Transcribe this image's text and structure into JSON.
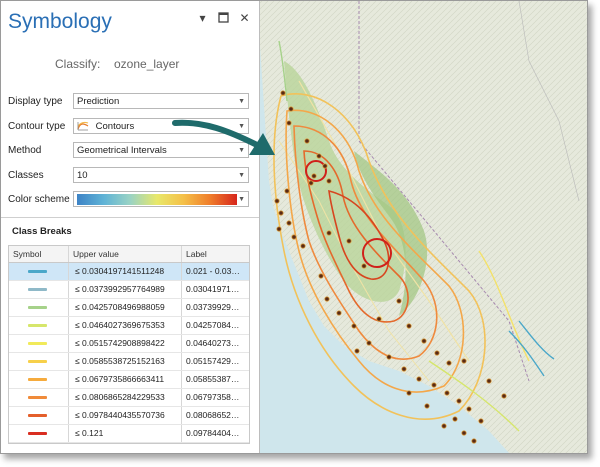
{
  "panel": {
    "title": "Symbology",
    "classify_label": "Classify:",
    "classify_value": "ozone_layer",
    "rows": {
      "display_type": {
        "label": "Display type",
        "value": "Prediction"
      },
      "contour_type": {
        "label": "Contour type",
        "value": "Contours"
      },
      "method": {
        "label": "Method",
        "value": "Geometrical Intervals"
      },
      "classes": {
        "label": "Classes",
        "value": "10"
      },
      "color_scheme": {
        "label": "Color scheme"
      }
    },
    "class_breaks": {
      "title": "Class Breaks",
      "headers": {
        "symbol": "Symbol",
        "upper": "Upper value",
        "label": "Label"
      },
      "rows": [
        {
          "upper": "≤  0.0304197141511248",
          "label": "0.021 - 0.03…",
          "color": "#4aa7c9"
        },
        {
          "upper": "≤  0.0373992957764989",
          "label": "0.03041971…",
          "color": "#8fb9c8"
        },
        {
          "upper": "≤  0.0425708496988059",
          "label": "0.03739929…",
          "color": "#a6d28a"
        },
        {
          "upper": "≤  0.0464027369675353",
          "label": "0.04257084…",
          "color": "#d6e66b"
        },
        {
          "upper": "≤  0.0515742908898422",
          "label": "0.04640273…",
          "color": "#f1ea5a"
        },
        {
          "upper": "≤  0.0585538725152163",
          "label": "0.05157429…",
          "color": "#f7d04a"
        },
        {
          "upper": "≤  0.0679735866663411",
          "label": "0.05855387…",
          "color": "#f6ab3d"
        },
        {
          "upper": "≤  0.0806865284229533",
          "label": "0.06797358…",
          "color": "#f08b3a"
        },
        {
          "upper": "≤  0.0978440435570736",
          "label": "0.08068652…",
          "color": "#e45f2b"
        },
        {
          "upper": "≤  0.121",
          "label": "0.09784404…",
          "color": "#d92e21"
        }
      ]
    }
  },
  "colors": {
    "title": "#2a6fb5",
    "arrow": "#1f6b6b",
    "selected_row": "#cfe6f7"
  },
  "icons": {
    "menu": "dropdown-triangle",
    "pin": "maximize-square",
    "close": "close-x"
  }
}
